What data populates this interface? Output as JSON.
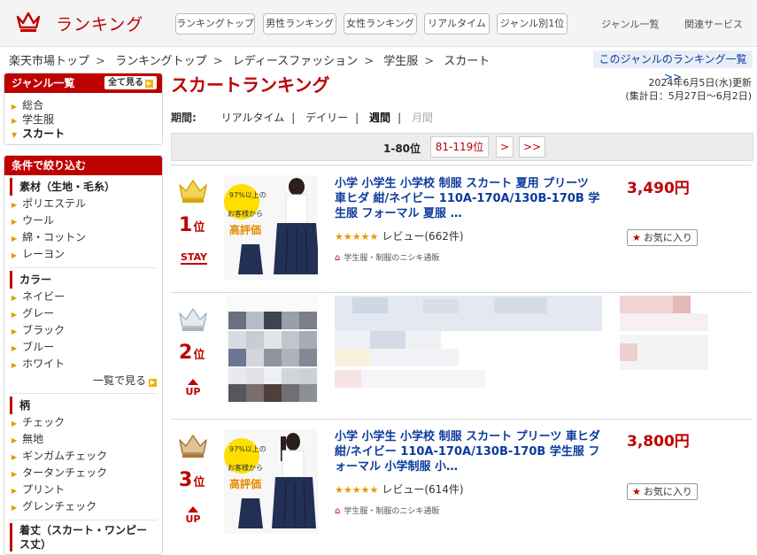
{
  "header": {
    "logo_text": "ランキング",
    "nav": [
      "ランキングトップ",
      "男性ランキング",
      "女性ランキング",
      "リアルタイム",
      "ジャンル別1位"
    ],
    "links": [
      "ジャンル一覧",
      "関連サービス"
    ]
  },
  "breadcrumb": {
    "items": [
      "楽天市場トップ",
      "ランキングトップ",
      "レディースファッション",
      "学生服",
      "スカート"
    ],
    "separator": ">",
    "genre_link": "このジャンルのランキング一覧 >>"
  },
  "sidebar": {
    "genre": {
      "heading": "ジャンル一覧",
      "all_button": "全て見る",
      "items": [
        "総合",
        "学生服",
        "スカート"
      ]
    },
    "filter": {
      "heading": "条件で絞り込む",
      "material": {
        "title": "素材（生地・毛糸）",
        "items": [
          "ポリエステル",
          "ウール",
          "綿・コットン",
          "レーヨン"
        ]
      },
      "color": {
        "title": "カラー",
        "items": [
          "ネイビー",
          "グレー",
          "ブラック",
          "ブルー",
          "ホワイト"
        ],
        "more": "一覧で見る"
      },
      "pattern": {
        "title": "柄",
        "items": [
          "チェック",
          "無地",
          "ギンガムチェック",
          "タータンチェック",
          "プリント",
          "グレンチェック"
        ]
      },
      "wear": {
        "title": "着丈（スカート・ワンピース丈）"
      }
    }
  },
  "main": {
    "title": "スカートランキング",
    "updated": "2024年6月5日(水)更新",
    "period_total": "(集計日：5月27日〜6月2日)",
    "period_label": "期間:",
    "period_options": [
      "リアルタイム",
      "デイリー",
      "週間",
      "月間"
    ],
    "period_sep": "|",
    "pager": {
      "current": "1-80位",
      "next_range": "81-119位",
      "next": ">",
      "last": ">>"
    },
    "rank_suffix": "位",
    "review_label_prefix": "レビュー",
    "items": [
      {
        "rank": "1",
        "status": "STAY",
        "title": "小学 小学生 小学校 制服 スカート 夏用 プリーツ 車ヒダ 紺/ネイビー 110A-170A/130B-170B 学生服 フォーマル 夏服 …",
        "stars": "★★★★★",
        "reviews": "レビュー(662件)",
        "shop": "学生服・制服のニシキ通販",
        "price": "3,490円",
        "fav": "お気に入り",
        "badge_line1": "97%以上の",
        "badge_line2": "お客様から",
        "badge_line3": "高評価"
      },
      {
        "rank": "2",
        "status": "UP"
      },
      {
        "rank": "3",
        "status": "UP",
        "title": "小学 小学生 小学校 制服 スカート プリーツ 車ヒダ 紺/ネイビー 110A-170A/130B-170B 学生服 フォーマル 小学制服 小…",
        "stars": "★★★★★",
        "reviews": "レビュー(614件)",
        "shop": "学生服・制服のニシキ通販",
        "price": "3,800円",
        "fav": "お気に入り",
        "badge_line1": "97%以上の",
        "badge_line2": "お客様から",
        "badge_line3": "高評価"
      }
    ]
  },
  "colors": {
    "brand": "#bf0000",
    "link": "#0b3b9c",
    "gold": "#e0b100",
    "silver": "#b9c3cc",
    "bronze": "#b7894d"
  }
}
